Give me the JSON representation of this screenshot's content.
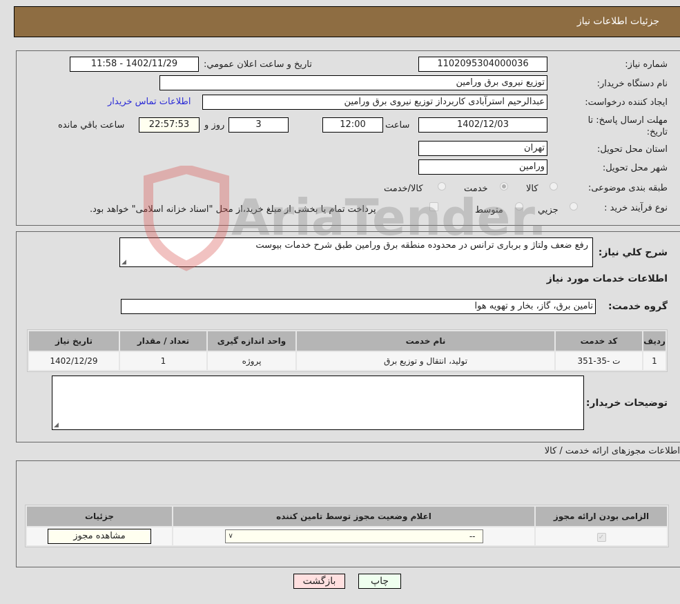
{
  "header": {
    "title": "جزئیات اطلاعات نیاز"
  },
  "need_info": {
    "need_number": {
      "label": "شماره نیاز:",
      "value": "1102095304000036"
    },
    "announce": {
      "label": "تاریخ و ساعت اعلان عمومي:",
      "value": "1402/11/29 - 11:58"
    },
    "buyer_org": {
      "label": "نام دستگاه خريدار:",
      "value": "توزیع نیروی برق ورامین"
    },
    "requester": {
      "label": "ایجاد کننده درخواست:",
      "value": "عبدالرحیم استرآبادی کاربرداز توزیع نیروی برق ورامین",
      "contact_link": "اطلاعات تماس خریدار"
    },
    "deadline": {
      "label": "مهلت ارسال پاسخ: تا تاریخ:",
      "date": "1402/12/03",
      "time_label": "ساعت",
      "time": "12:00",
      "days": "3",
      "days_label": "روز و",
      "remaining": "22:57:53",
      "remaining_label": "ساعت باقي مانده"
    },
    "province": {
      "label": "استان محل تحویل:",
      "value": "تهران"
    },
    "city": {
      "label": "شهر محل تحویل:",
      "value": "ورامین"
    },
    "category": {
      "label": "طبقه بندی موضوعی:",
      "options": [
        {
          "label": "کالا",
          "selected": false
        },
        {
          "label": "خدمت",
          "selected": true
        },
        {
          "label": "کالا/خدمت",
          "selected": false
        }
      ]
    },
    "purchase_type": {
      "label": "نوع فرآیند خرید :",
      "options": [
        {
          "label": "جزيي",
          "selected": false
        },
        {
          "label": "متوسط",
          "selected": false
        }
      ],
      "treasury_note": "پرداخت تمام یا بخشی از مبلغ خرید،از محل \"اسناد خزانه اسلامی\" خواهد بود."
    }
  },
  "description": {
    "label": "شرح کلي نياز:",
    "value": "رفع ضعف ولتاژ و برباری ترانس در محدوده منطقه برق ورامین طبق شرح خدمات بیوست"
  },
  "services": {
    "section_title": "اطلاعات خدمات مورد نياز",
    "group_label": "گروه خدمت:",
    "group_value": "تامین برق، گاز، بخار و تهویه هوا",
    "table": {
      "headers": [
        "ردیف",
        "کد خدمت",
        "نام خدمت",
        "واحد اندازه گیری",
        "تعداد / مقدار",
        "تاریخ نیاز"
      ],
      "rows": [
        [
          "1",
          "ت -35-351",
          "تولید، انتقال و توزیع برق",
          "پروژه",
          "1",
          "1402/12/29"
        ]
      ]
    }
  },
  "buyer_notes": {
    "label": "توضیحات خریدار:",
    "value": ""
  },
  "permits": {
    "section_title": "اطلاعات مجوزهای ارائه خدمت / کالا",
    "table": {
      "headers": [
        "الزامی بودن ارائه مجوز",
        "اعلام وضعیت مجوز توسط تامین کننده",
        "جزئیات"
      ],
      "rows": [
        {
          "required_checked": true,
          "status_value": "--",
          "details_button": "مشاهده مجوز"
        }
      ]
    }
  },
  "footer": {
    "print_button": "چاپ",
    "back_button": "بازگشت"
  },
  "watermark": {
    "text": "AriaTender.neT"
  },
  "colors": {
    "header_bg": "#8e6d42",
    "link": "#2b2bd6",
    "back_bg": "#ffe0e0",
    "print_bg": "#efffef"
  }
}
